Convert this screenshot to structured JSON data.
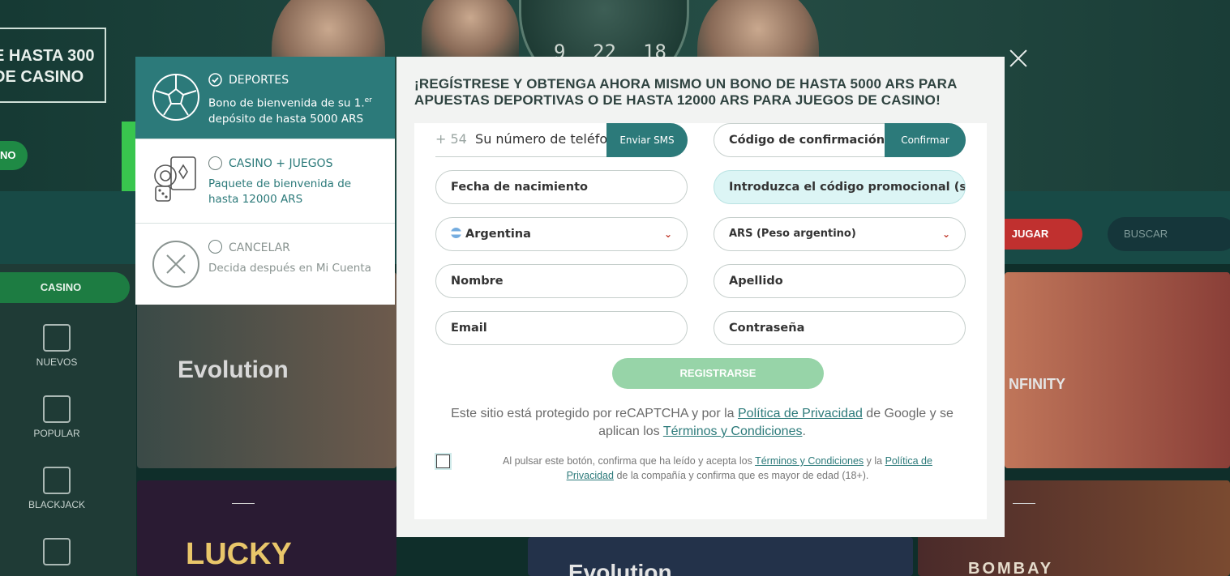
{
  "background": {
    "promo_line1": "E HASTA 300",
    "promo_line2": "DE CASINO",
    "green_pill_label": "NO",
    "wheel_numbers": [
      "9",
      "22",
      "18"
    ],
    "jugar_label": "JUGAR",
    "buscar_placeholder": "BUSCAR",
    "casino_tab": "CASINO",
    "sidebar": [
      {
        "label": "NUEVOS",
        "icon": "dice-icon"
      },
      {
        "label": "POPULAR",
        "icon": "slot-machine-icon"
      },
      {
        "label": "BLACKJACK",
        "icon": "cards-icon"
      },
      {
        "label": "",
        "icon": "poker-cards-icon"
      }
    ],
    "tiles": {
      "evolution": "Evolution",
      "infinity": "NFINITY",
      "lucky": "LUCKY",
      "evolution2": "Evolution",
      "bombay": "BOMBAY"
    }
  },
  "bonus": {
    "options": [
      {
        "title": "DEPORTES",
        "desc_a": "Bono de bienvenida de su 1.",
        "desc_sup": "er",
        "desc_b": "depósito de hasta 5000 ARS",
        "selected": true,
        "icon": "soccer-ball-icon"
      },
      {
        "title": "CASINO + JUEGOS",
        "desc_a": "Paquete de bienvenida de hasta 12000 ARS",
        "selected": false,
        "icon": "casino-chips-icon"
      },
      {
        "title": "CANCELAR",
        "desc_a": "Decida después en Mi Cuenta",
        "selected": false,
        "icon": "cancel-circle-icon"
      }
    ]
  },
  "modal": {
    "title": "¡REGÍSTRESE Y OBTENGA AHORA MISMO UN BONO DE HASTA 5000 ARS PARA APUESTAS DEPORTIVAS O DE HASTA 12000 ARS PARA JUEGOS DE CASINO!",
    "phone_prefix": "+ 54",
    "phone_placeholder": "Su número de teléfono",
    "send_sms": "Enviar SMS",
    "confirmation_placeholder": "Código de confirmación",
    "confirm": "Confirmar",
    "birthdate_placeholder": "Fecha de nacimiento",
    "promo_placeholder": "Introduzca el código promocional (si lo",
    "country": "Argentina",
    "currency": "ARS (Peso argentino)",
    "name_placeholder": "Nombre",
    "surname_placeholder": "Apellido",
    "email_placeholder": "Email",
    "password_placeholder": "Contraseña",
    "register": "REGISTRARSE",
    "recaptcha_a": "Este sitio está protegido por reCAPTCHA y por la ",
    "recaptcha_link1": "Política de Privacidad",
    "recaptcha_b": " de Google y se aplican los ",
    "recaptcha_link2": "Términos y Condiciones",
    "recaptcha_c": ".",
    "terms_a": "Al pulsar este botón, confirma que ha leído y acepta los ",
    "terms_link1": "Términos y Condiciones",
    "terms_b": " y la ",
    "terms_link2": "Política de Privacidad",
    "terms_c": " de la compañía y confirma que es mayor de edad (18+)."
  },
  "colors": {
    "accent": "#2c7a7a",
    "register_disabled": "#97d4a8",
    "promo_field_bg": "#dcf5f5",
    "jugar": "#c0302f"
  }
}
